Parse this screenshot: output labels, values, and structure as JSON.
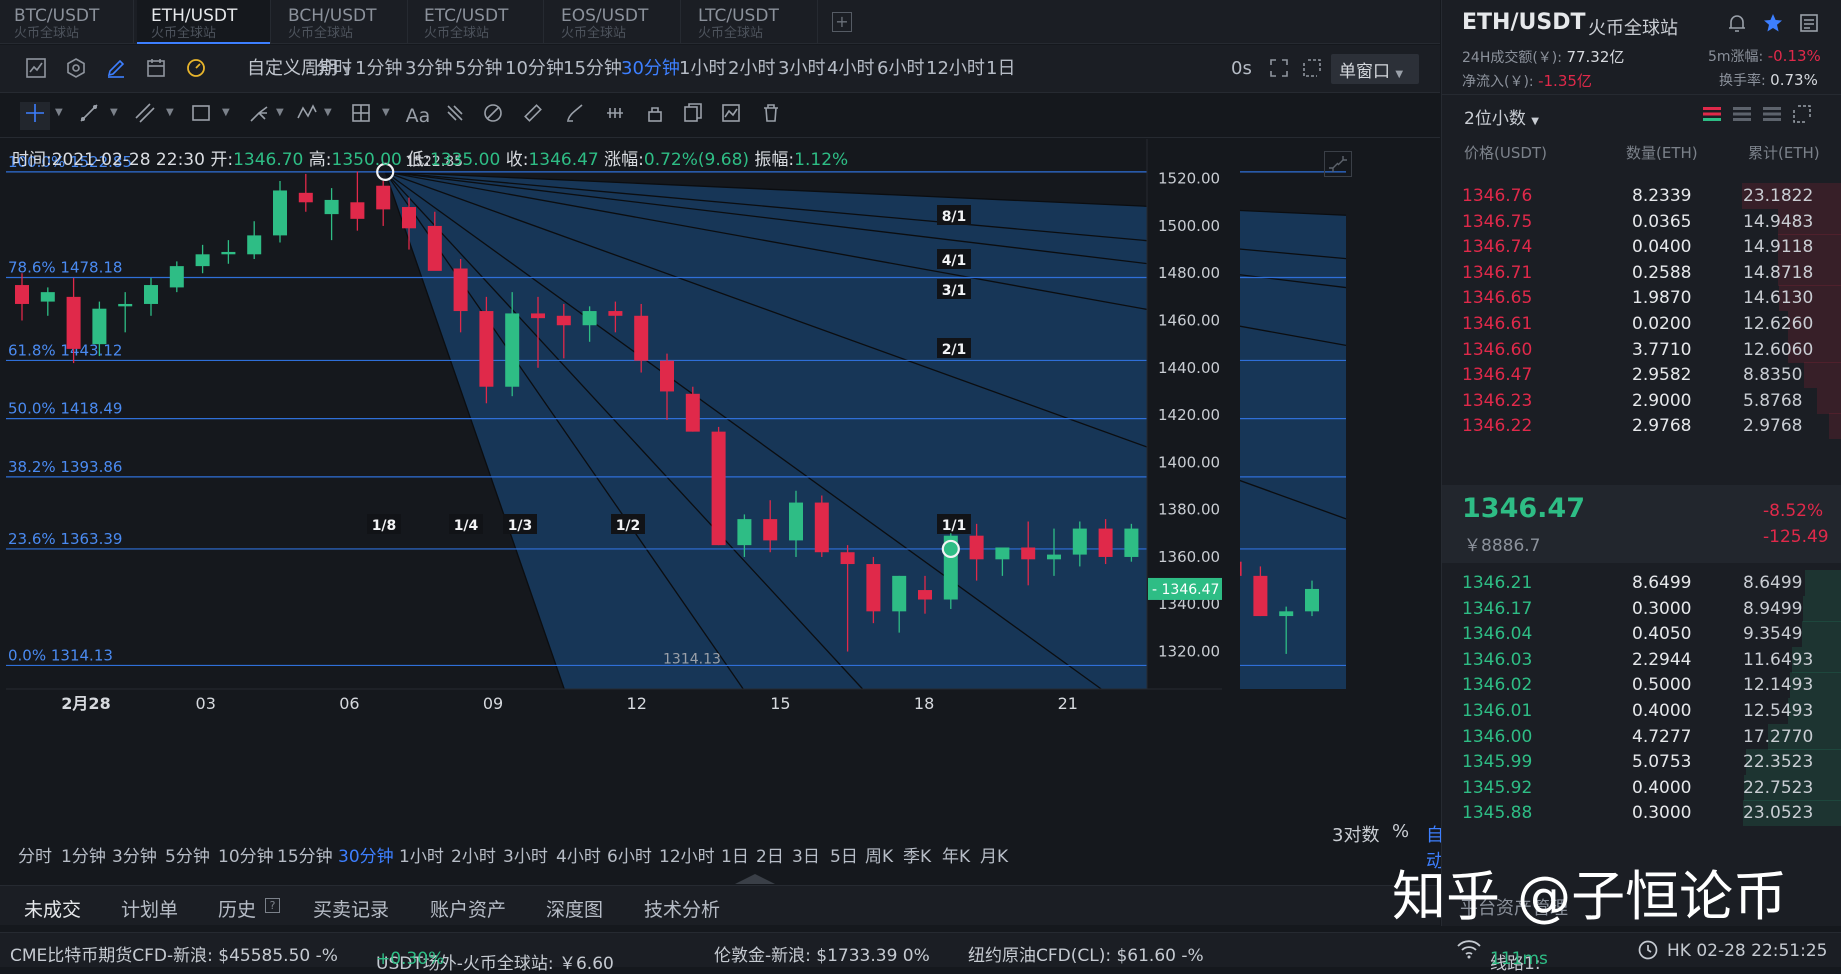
{
  "symbol_tabs": [
    {
      "pair": "BTC/USDT",
      "site": "火币全球站"
    },
    {
      "pair": "ETH/USDT",
      "site": "火币全球站"
    },
    {
      "pair": "BCH/USDT",
      "site": "火币全球站"
    },
    {
      "pair": "ETC/USDT",
      "site": "火币全球站"
    },
    {
      "pair": "EOS/USDT",
      "site": "火币全球站"
    },
    {
      "pair": "LTC/USDT",
      "site": "火币全球站"
    }
  ],
  "add_tab": "+",
  "toolbar": {
    "custom_period": "自定义周期",
    "periods": [
      "分时",
      "1分钟",
      "3分钟",
      "5分钟",
      "10分钟",
      "15分钟",
      "30分钟",
      "1小时",
      "2小时",
      "3小时",
      "4小时",
      "6小时",
      "12小时",
      "1日"
    ],
    "active_period": "30分钟",
    "countdown": "0s",
    "window_mode": "单窗口"
  },
  "ohlc": {
    "time_label": "时间:",
    "time": "2021-02-28 22:30",
    "open_label": "开:",
    "open": "1346.70",
    "high_label": "高:",
    "high": "1350.00",
    "low_label": "低:",
    "low": "1335.00",
    "close_label": "收:",
    "close": "1346.47",
    "change_label": "涨幅:",
    "change": "0.72%(9.68)",
    "amp_label": "振幅:",
    "amp": "1.12%"
  },
  "chart_data": {
    "type": "candlestick",
    "y_range": [
      1305,
      1530
    ],
    "y_ticks": [
      "1520.00",
      "1500.00",
      "1480.00",
      "1460.00",
      "1440.00",
      "1420.00",
      "1400.00",
      "1380.00",
      "1360.00",
      "1340.00",
      "1320.00"
    ],
    "y_tick_values": [
      1520,
      1500,
      1480,
      1460,
      1440,
      1420,
      1400,
      1380,
      1360,
      1340,
      1320
    ],
    "x_labels": [
      "2月28",
      "03",
      "06",
      "09",
      "12",
      "15",
      "18",
      "21"
    ],
    "x_label_index": [
      0,
      5,
      11,
      17,
      23,
      29,
      35,
      41
    ],
    "last_price_tag": "1346.47",
    "fib_levels": [
      {
        "label": "100.0% 1522.85",
        "value": 1522.85
      },
      {
        "label": "78.6% 1478.18",
        "value": 1478.18
      },
      {
        "label": "61.8% 1443.12",
        "value": 1443.12
      },
      {
        "label": "50.0% 1418.49",
        "value": 1418.49
      },
      {
        "label": "38.2% 1393.86",
        "value": 1393.86
      },
      {
        "label": "23.6% 1363.39",
        "value": 1363.39
      },
      {
        "label": "0.0% 1314.13",
        "value": 1314.13
      }
    ],
    "high_marker": "1522.85",
    "low_marker": "1314.13",
    "gann_labels": [
      "8/1",
      "4/1",
      "3/1",
      "2/1",
      "1/1",
      "1/2",
      "1/3",
      "1/4",
      "1/8"
    ],
    "candles": [
      [
        1475,
        1480,
        1460,
        1467
      ],
      [
        1468,
        1474,
        1462,
        1472
      ],
      [
        1470,
        1478,
        1442,
        1448
      ],
      [
        1450,
        1468,
        1445,
        1465
      ],
      [
        1466,
        1472,
        1455,
        1467
      ],
      [
        1467,
        1478,
        1462,
        1475
      ],
      [
        1474,
        1485,
        1472,
        1483
      ],
      [
        1483,
        1492,
        1480,
        1488
      ],
      [
        1488,
        1494,
        1484,
        1489
      ],
      [
        1488,
        1502,
        1486,
        1496
      ],
      [
        1496,
        1519,
        1493,
        1515
      ],
      [
        1514,
        1522,
        1506,
        1510
      ],
      [
        1505,
        1516,
        1494,
        1511
      ],
      [
        1510,
        1523,
        1498,
        1503
      ],
      [
        1517,
        1519,
        1500,
        1507
      ],
      [
        1508,
        1512,
        1490,
        1499
      ],
      [
        1500,
        1506,
        1483,
        1481
      ],
      [
        1482,
        1486,
        1455,
        1464
      ],
      [
        1464,
        1470,
        1425,
        1432
      ],
      [
        1432,
        1472,
        1428,
        1463
      ],
      [
        1463,
        1470,
        1440,
        1461
      ],
      [
        1462,
        1467,
        1444,
        1458
      ],
      [
        1458,
        1466,
        1451,
        1464
      ],
      [
        1464,
        1468,
        1455,
        1462
      ],
      [
        1462,
        1467,
        1438,
        1443
      ],
      [
        1443,
        1446,
        1418,
        1430
      ],
      [
        1429,
        1432,
        1413,
        1413
      ],
      [
        1413,
        1415,
        1365,
        1365
      ],
      [
        1365,
        1378,
        1360,
        1376
      ],
      [
        1376,
        1384,
        1362,
        1367
      ],
      [
        1367,
        1388,
        1360,
        1383
      ],
      [
        1383,
        1386,
        1360,
        1362
      ],
      [
        1362,
        1365,
        1320,
        1357
      ],
      [
        1357,
        1360,
        1332,
        1337
      ],
      [
        1337,
        1352,
        1328,
        1352
      ],
      [
        1346,
        1352,
        1336,
        1342
      ],
      [
        1342,
        1370,
        1338,
        1369
      ],
      [
        1369,
        1374,
        1350,
        1359
      ],
      [
        1359,
        1362,
        1352,
        1364
      ],
      [
        1364,
        1375,
        1348,
        1359
      ],
      [
        1359,
        1372,
        1352,
        1361
      ],
      [
        1361,
        1375,
        1356,
        1372
      ],
      [
        1372,
        1376,
        1357,
        1360
      ],
      [
        1360,
        1374,
        1358,
        1372
      ],
      [
        1372,
        1381,
        1365,
        1366
      ],
      [
        1366,
        1380,
        1354,
        1362
      ],
      [
        1362,
        1366,
        1346,
        1358
      ],
      [
        1358,
        1362,
        1345,
        1352
      ],
      [
        1352,
        1356,
        1335,
        1335
      ],
      [
        1335,
        1339,
        1319,
        1337
      ],
      [
        1337,
        1350,
        1335,
        1346.47
      ]
    ]
  },
  "chart_footer": {
    "log_label": "3对数",
    "pct_label": "%",
    "auto_label": "自动"
  },
  "bottom_periods": [
    "分时",
    "1分钟",
    "3分钟",
    "5分钟",
    "10分钟",
    "15分钟",
    "30分钟",
    "1小时",
    "2小时",
    "3小时",
    "4小时",
    "6小时",
    "12小时",
    "1日",
    "2日",
    "3日",
    "5日",
    "周K",
    "季K",
    "年K",
    "月K"
  ],
  "bottom_active_period": "30分钟",
  "bottom_tabs": [
    "未成交",
    "计划单",
    "历史",
    "买卖记录",
    "账户资产",
    "深度图",
    "技术分析"
  ],
  "right_panel": {
    "pair": "ETH/USDT",
    "site": "火币全球站",
    "vol24_label": "24H成交额(￥):",
    "vol24": "77.32亿",
    "rise5m_label": "5m涨幅:",
    "rise5m": "-0.13%",
    "inflow_label": "净流入(￥):",
    "inflow": "-1.35亿",
    "turnover_label": "换手率:",
    "turnover": "0.73%",
    "decimals": "2位小数",
    "col_price": "价格(USDT)",
    "col_qty": "数量(ETH)",
    "col_cum": "累计(ETH)",
    "asks": [
      [
        "1346.76",
        "8.2339",
        "23.1822"
      ],
      [
        "1346.75",
        "0.0365",
        "14.9483"
      ],
      [
        "1346.74",
        "0.0400",
        "14.9118"
      ],
      [
        "1346.71",
        "0.2588",
        "14.8718"
      ],
      [
        "1346.65",
        "1.9870",
        "14.6130"
      ],
      [
        "1346.61",
        "0.0200",
        "12.6260"
      ],
      [
        "1346.60",
        "3.7710",
        "12.6060"
      ],
      [
        "1346.47",
        "2.9582",
        "8.8350"
      ],
      [
        "1346.23",
        "2.9000",
        "5.8768"
      ],
      [
        "1346.22",
        "2.9768",
        "2.9768"
      ]
    ],
    "last_price": "1346.47",
    "last_cny": "￥8886.7",
    "change_pct": "-8.52%",
    "change_abs": "-125.49",
    "bids": [
      [
        "1346.21",
        "8.6499",
        "8.6499"
      ],
      [
        "1346.17",
        "0.3000",
        "8.9499"
      ],
      [
        "1346.04",
        "0.4050",
        "9.3549"
      ],
      [
        "1346.03",
        "2.2944",
        "11.6493"
      ],
      [
        "1346.02",
        "0.5000",
        "12.1493"
      ],
      [
        "1346.01",
        "0.4000",
        "12.5493"
      ],
      [
        "1346.00",
        "4.7277",
        "17.2770"
      ],
      [
        "1345.99",
        "5.0753",
        "22.3523"
      ],
      [
        "1345.92",
        "0.4000",
        "22.7523"
      ],
      [
        "1345.88",
        "0.3000",
        "23.0523"
      ]
    ],
    "asset_mgmt": "平台资产管理"
  },
  "ticker": {
    "cme": "CME比特币期货CFD-新浪: $45585.50 -%",
    "usdt_otc_label": "USDT场外-火币全球站: ￥6.60",
    "usdt_otc_change": "+0.30%",
    "gold": "伦敦金-新浪: $1733.39 0%",
    "oil": "纽约原油CFD(CL): $61.60 -%",
    "line": "线路1:",
    "latency": "111ms",
    "clock": "HK 02-28 22:51:25"
  },
  "watermark": "知乎 @子恒论币",
  "colors": {
    "up": "#2ebd85",
    "down": "#e0294a",
    "accent": "#3d7fff",
    "gann_fill": "#173a5e"
  }
}
